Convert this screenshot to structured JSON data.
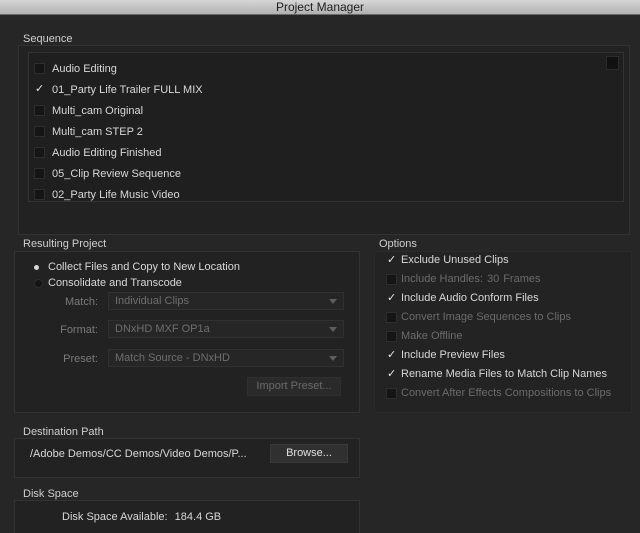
{
  "window": {
    "title": "Project Manager"
  },
  "sequence": {
    "label": "Sequence",
    "items": [
      {
        "label": "Audio Editing",
        "checked": false
      },
      {
        "label": "01_Party Life Trailer FULL MIX",
        "checked": true
      },
      {
        "label": "Multi_cam Original",
        "checked": false
      },
      {
        "label": "Multi_cam STEP 2",
        "checked": false
      },
      {
        "label": "Audio Editing Finished",
        "checked": false
      },
      {
        "label": "05_Clip Review Sequence",
        "checked": false
      },
      {
        "label": "02_Party Life Music Video",
        "checked": false
      }
    ]
  },
  "resulting_project": {
    "label": "Resulting Project",
    "collect_label": "Collect Files and Copy to New Location",
    "consolidate_label": "Consolidate and Transcode",
    "selected": "collect",
    "match_label": "Match:",
    "match_value": "Individual Clips",
    "format_label": "Format:",
    "format_value": "DNxHD MXF OP1a",
    "preset_label": "Preset:",
    "preset_value": "Match Source - DNxHD",
    "import_preset_label": "Import Preset..."
  },
  "options": {
    "label": "Options",
    "exclude_unused": {
      "label": "Exclude Unused Clips",
      "checked": true,
      "enabled": true
    },
    "include_handles": {
      "label": "Include Handles:",
      "value": "30",
      "unit": "Frames",
      "checked": false,
      "enabled": false
    },
    "include_audio_conform": {
      "label": "Include Audio Conform Files",
      "checked": true,
      "enabled": true
    },
    "convert_image_sequences": {
      "label": "Convert Image Sequences to Clips",
      "checked": false,
      "enabled": false
    },
    "make_offline": {
      "label": "Make Offline",
      "checked": false,
      "enabled": false
    },
    "include_preview": {
      "label": "Include Preview Files",
      "checked": true,
      "enabled": true
    },
    "rename_media": {
      "label": "Rename Media Files to Match Clip Names",
      "checked": true,
      "enabled": true
    },
    "convert_ae": {
      "label": "Convert After Effects Compositions to Clips",
      "checked": false,
      "enabled": false
    }
  },
  "destination": {
    "label": "Destination Path",
    "path": "/Adobe Demos/CC Demos/Video Demos/P...",
    "browse_label": "Browse..."
  },
  "disk_space": {
    "label": "Disk Space",
    "available_label": "Disk Space Available:",
    "available_value": "184.4 GB"
  }
}
